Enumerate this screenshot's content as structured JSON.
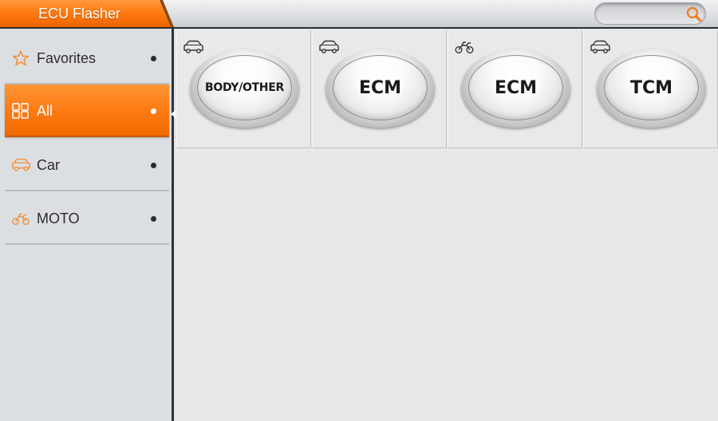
{
  "app": {
    "title": "ECU Flasher"
  },
  "search": {
    "placeholder": "",
    "value": "",
    "icon": "search-icon"
  },
  "colors": {
    "accent": "#ff7a10",
    "icon_orange": "#f08a2a"
  },
  "sidebar": {
    "items": [
      {
        "label": "Favorites",
        "icon": "star-icon",
        "active": false
      },
      {
        "label": "All",
        "icon": "grid-icon",
        "active": true
      },
      {
        "label": "Car",
        "icon": "car-icon",
        "active": false
      },
      {
        "label": "MOTO",
        "icon": "motorcycle-icon",
        "active": false
      }
    ]
  },
  "modules": [
    {
      "label": "BODY/OTHER",
      "vehicle": "car-icon"
    },
    {
      "label": "ECM",
      "vehicle": "car-icon"
    },
    {
      "label": "ECM",
      "vehicle": "motorcycle-icon"
    },
    {
      "label": "TCM",
      "vehicle": "car-icon"
    }
  ]
}
